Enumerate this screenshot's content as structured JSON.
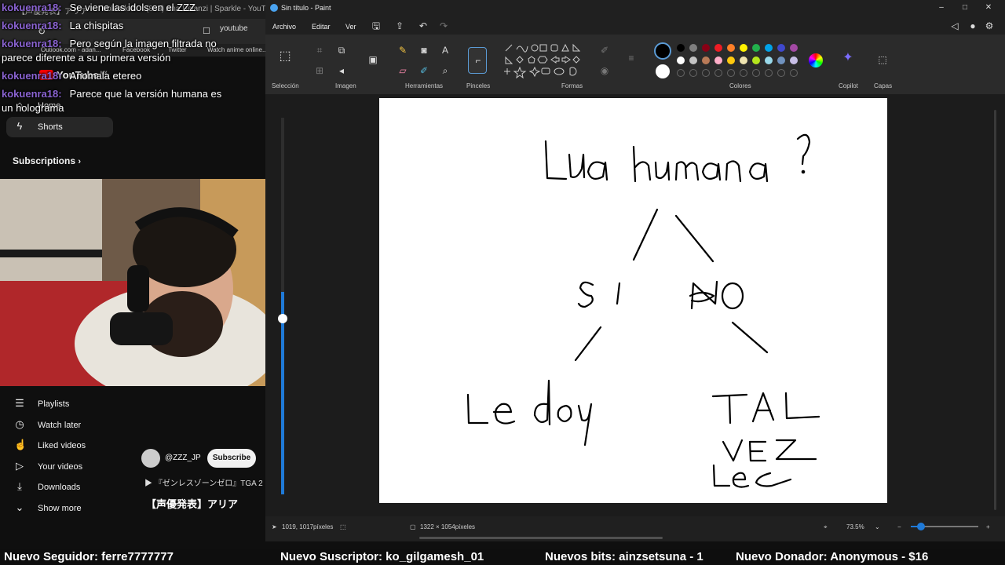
{
  "browser": {
    "tab1": "【声優発表】アリア",
    "tab2": "Voldados",
    "tab3": "(833) Ana Belanzi | Sparkle - YouTub",
    "address": "youtube",
    "bookmarks": [
      "Outlook.com - adan...",
      "Facebook",
      "Twitter",
      "Watch anime online..."
    ]
  },
  "youtube": {
    "logo": "YouTube",
    "region": "MX",
    "nav_home": "Home",
    "nav_shorts": "Shorts",
    "subscriptions": "Subscriptions",
    "library_items": [
      "Playlists",
      "Watch later",
      "Liked videos",
      "Your videos",
      "Downloads",
      "Show more"
    ],
    "channel_name": "@ZZZ_JP",
    "subscribe": "Subscribe",
    "video_title": "『ゼンレスゾーンゼロ』TGA 2",
    "video_heading": "【声優発表】アリア"
  },
  "chat": [
    {
      "user": "kokuenra18:",
      "text": "Se viene las idols en el ZZZ"
    },
    {
      "user": "kokuenra18:",
      "text": "La chispitas"
    },
    {
      "user": "kokuenra18:",
      "text": "Pero según la imagen filtrada no"
    },
    {
      "user": "",
      "text": "parece diferente a su primera versión"
    },
    {
      "user": "kokuenra18:",
      "text": "Anomala etereo"
    },
    {
      "user": "kokuenra18:",
      "text": "Parece que la versión humana es"
    },
    {
      "user": "",
      "text": "un holograma"
    }
  ],
  "paint": {
    "title": "Sin título - Paint",
    "menus": [
      "Archivo",
      "Editar",
      "Ver"
    ],
    "groups": [
      "Selección",
      "Imagen",
      "Herramientas",
      "Pinceles",
      "Formas",
      "Colores",
      "Copilot",
      "Capas"
    ],
    "status_cursor": "1019, 1017píxeles",
    "status_size": "1322 × 1054píxeles",
    "zoom": "73.5%",
    "palette": [
      "#000000",
      "#7f7f7f",
      "#880015",
      "#ed1c24",
      "#ff7f27",
      "#fff200",
      "#22b14c",
      "#00a2e8",
      "#3f48cc",
      "#a349a4",
      "#ffffff",
      "#c3c3c3",
      "#b97a57",
      "#ffaec9",
      "#ffc90e",
      "#efe4b0",
      "#b5e61d",
      "#99d9ea",
      "#7092be",
      "#c8bfe7"
    ]
  },
  "ticker": {
    "follower": "Nuevo Seguidor: ferre7777777",
    "subscriber": "Nuevo Suscriptor: ko_gilgamesh_01",
    "bits": "Nuevos bits: ainzsetsuna - 1",
    "donor": "Nuevo Donador: Anonymous - $16"
  }
}
